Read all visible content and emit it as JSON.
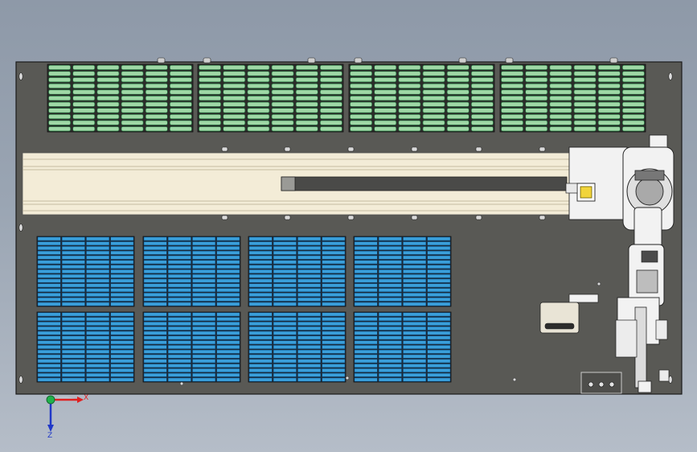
{
  "viewport": {
    "background_top": "#8e99a8",
    "background_bottom": "#b5bdc8"
  },
  "palette": {
    "base_plate": "#595955",
    "plate_edge": "#1a1a1a",
    "rail_cream": "#f3ecd7",
    "rail_line": "#b7ad90",
    "green_tray_fill": "#9fd8a6",
    "green_tray_dark": "#1f6b3a",
    "blue_tray_fill": "#3a9fda",
    "blue_tray_dark": "#0b4f85",
    "robot_white": "#f2f2f2",
    "robot_line": "#222222",
    "yellow_part": "#f1d43a",
    "axis_x": "#e02020",
    "axis_y": "#21b14b",
    "axis_z": "#2038c8"
  },
  "green_tray_banks": {
    "count": 4,
    "columns_per_bank": 6,
    "rows": 11
  },
  "blue_tray_banks": {
    "grid_columns": 4,
    "grid_rows": 2,
    "columns_per_bank": 4,
    "rows": 15
  },
  "linear_rail": {
    "bolt_count_per_side": 6
  },
  "triad": {
    "x_label": "X",
    "z_label": "Z",
    "icon": "coordinate-triad-icon"
  },
  "icons": [
    "coordinate-triad-icon"
  ]
}
